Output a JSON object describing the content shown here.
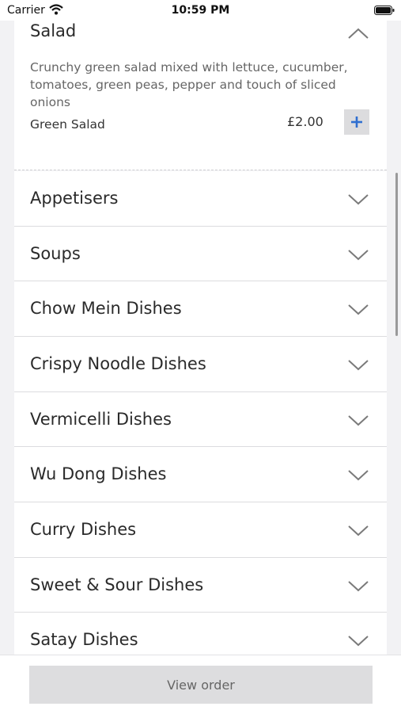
{
  "status_bar": {
    "carrier": "Carrier",
    "time": "10:59 PM"
  },
  "expanded_category": {
    "title": "Salad",
    "description": "Crunchy green salad mixed with lettuce, cucumber, tomatoes, green peas, pepper and touch of sliced onions",
    "item": {
      "name": "Green Salad",
      "price": "£2.00"
    }
  },
  "categories": [
    "Appetisers",
    "Soups",
    "Chow Mein Dishes",
    "Crispy Noodle Dishes",
    "Vermicelli Dishes",
    "Wu Dong Dishes",
    "Curry Dishes",
    "Sweet & Sour Dishes",
    "Satay Dishes"
  ],
  "footer": {
    "view_order_label": "View order"
  },
  "colors": {
    "accent": "#2f6fd0",
    "background": "#f2f2f4",
    "chevron": "#7a7a7a"
  }
}
